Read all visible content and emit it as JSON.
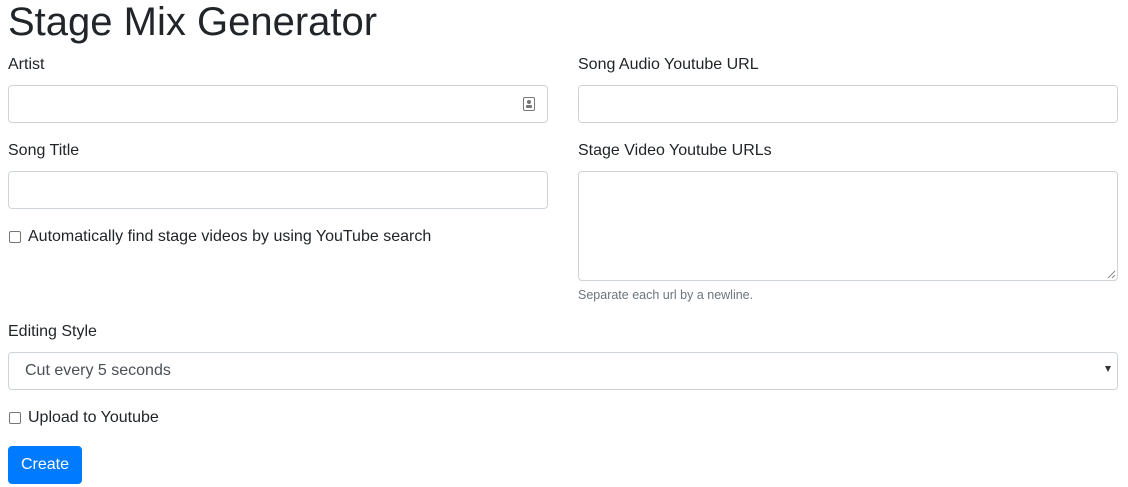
{
  "page": {
    "title": "Stage Mix Generator"
  },
  "form": {
    "artist": {
      "label": "Artist",
      "value": ""
    },
    "song_audio_url": {
      "label": "Song Audio Youtube URL",
      "value": ""
    },
    "song_title": {
      "label": "Song Title",
      "value": ""
    },
    "stage_video_urls": {
      "label": "Stage Video Youtube URLs",
      "value": "",
      "help": "Separate each url by a newline."
    },
    "auto_find": {
      "label": "Automatically find stage videos by using YouTube search",
      "checked": false
    },
    "editing_style": {
      "label": "Editing Style",
      "selected": "Cut every 5 seconds"
    },
    "upload": {
      "label": "Upload to Youtube",
      "checked": false
    },
    "submit_label": "Create"
  },
  "colors": {
    "primary": "#007bff",
    "text": "#212529",
    "muted": "#6c757d",
    "border": "#ced4da"
  }
}
